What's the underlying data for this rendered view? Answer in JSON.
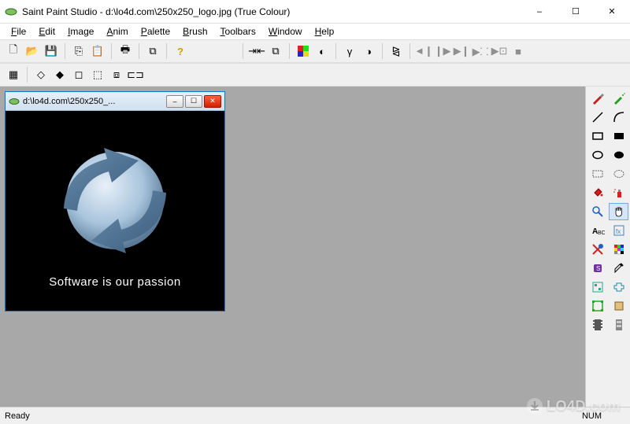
{
  "titlebar": {
    "title": "Saint Paint Studio - d:\\lo4d.com\\250x250_logo.jpg (True Colour)"
  },
  "window_controls": {
    "minimize": "–",
    "maximize": "☐",
    "close": "✕"
  },
  "menu": {
    "file": "File",
    "edit": "Edit",
    "image": "Image",
    "anim": "Anim",
    "palette": "Palette",
    "brush": "Brush",
    "toolbars": "Toolbars",
    "window": "Window",
    "help": "Help"
  },
  "toolbar1": {
    "new": "🗋",
    "open": "📂",
    "save": "💾",
    "copy": "⎘",
    "paste": "📋",
    "print": "🖶",
    "clone": "⧉",
    "help": "?"
  },
  "toolbar2_group1": {
    "b1": "⇥⇤",
    "b2": "⧉"
  },
  "toolbar2_group2": {
    "b1": "▦",
    "b2": "◐"
  },
  "toolbar2_group3": {
    "b1": "γ",
    "b2": "◑"
  },
  "toolbar2_group4": {
    "b1": "⧎"
  },
  "toolbar2_group5": {
    "b1": "◄❙",
    "b2": "❙▶",
    "b3": "▶❙",
    "b4": "▶⸬",
    "b5": "▶⊡",
    "b6": "■"
  },
  "toolbar3": {
    "b1": "▦",
    "b2": "◇",
    "b3": "◆",
    "b4": "◻",
    "b5": "⬚",
    "b6": "⧈",
    "b7": "⊏⊐"
  },
  "child_window": {
    "title": "d:\\lo4d.com\\250x250_...",
    "caption": "Software is our passion",
    "minimize": "–",
    "maximize": "☐",
    "close": "✕"
  },
  "tools_panel_names": [
    [
      "paintbrush-icon",
      "airbrush-icon"
    ],
    [
      "line-icon",
      "curve-icon"
    ],
    [
      "rectangle-icon",
      "filled-rectangle-icon"
    ],
    [
      "ellipse-icon",
      "filled-ellipse-icon"
    ],
    [
      "select-rect-icon",
      "select-ellipse-icon"
    ],
    [
      "fill-icon",
      "spray-icon"
    ],
    [
      "zoom-icon",
      "hand-icon"
    ],
    [
      "text-icon",
      "fx-icon"
    ],
    [
      "erase-color-icon",
      "color-grid-icon"
    ],
    [
      "stamp-icon",
      "picker-icon"
    ],
    [
      "pattern-icon",
      "plugin-icon"
    ],
    [
      "region-icon",
      "crop-icon"
    ],
    [
      "film-icon",
      "film2-icon"
    ]
  ],
  "statusbar": {
    "ready": "Ready",
    "num": "NUM"
  },
  "watermark": {
    "text": "LO4D.com"
  }
}
